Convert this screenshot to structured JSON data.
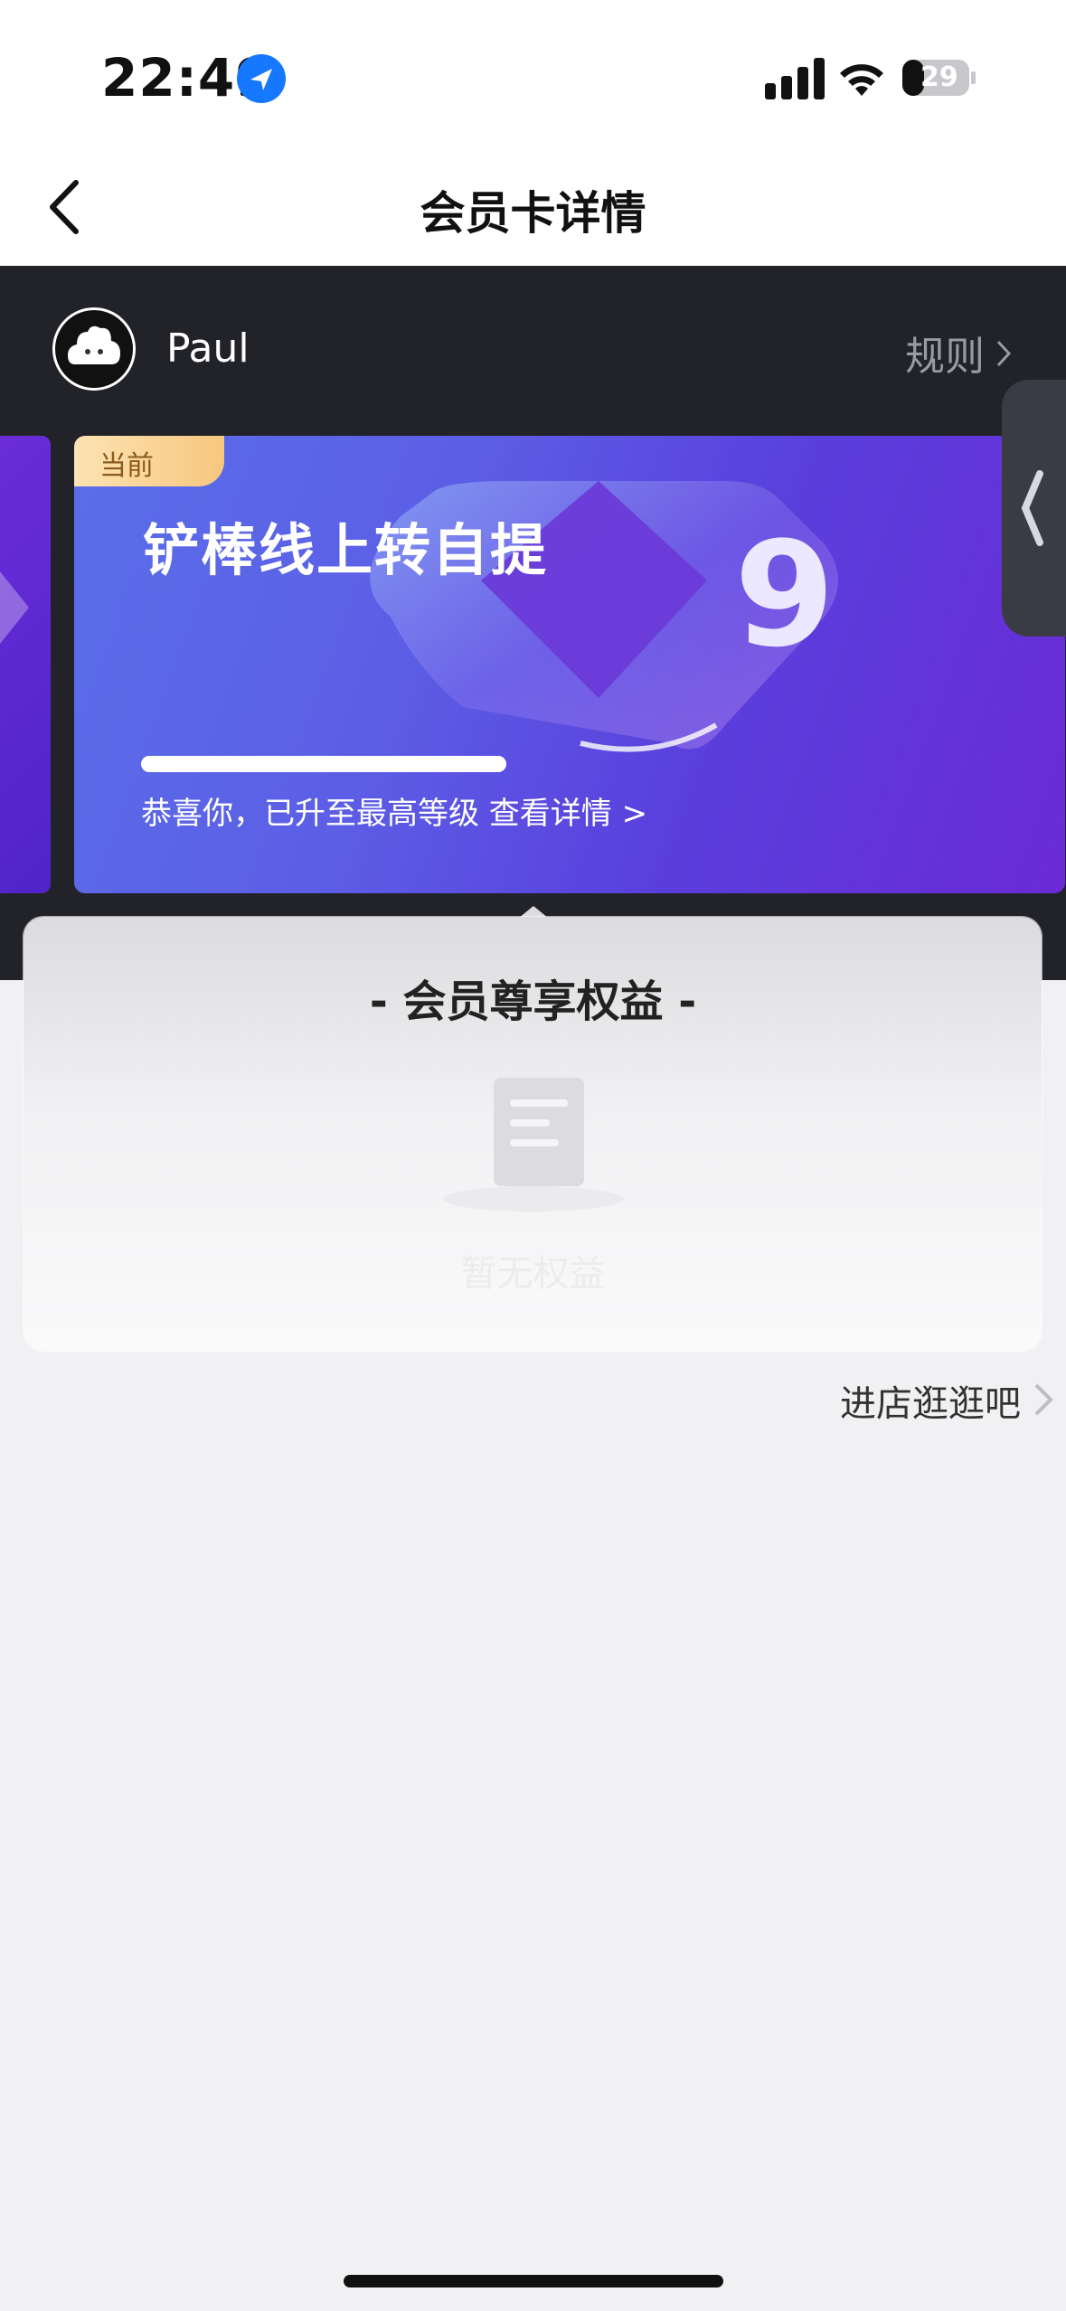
{
  "status_bar": {
    "time": "22:49",
    "battery": "29"
  },
  "nav": {
    "title": "会员卡详情"
  },
  "user": {
    "name": "Paul",
    "rules_label": "规则"
  },
  "card": {
    "badge": "当前",
    "title": "铲棒线上转自提",
    "level": "9",
    "progress": 1.0,
    "subtitle": "恭喜你，已升至最高等级 查看详情 >"
  },
  "benefits": {
    "title": "- 会员尊享权益 -",
    "empty_text": "暂无权益"
  },
  "shop_link": "进店逛逛吧",
  "colors": {
    "accent": "#1677ff",
    "dark_header": "#222329",
    "card_start": "#5a6fe8",
    "card_end": "#6a2ad6"
  }
}
